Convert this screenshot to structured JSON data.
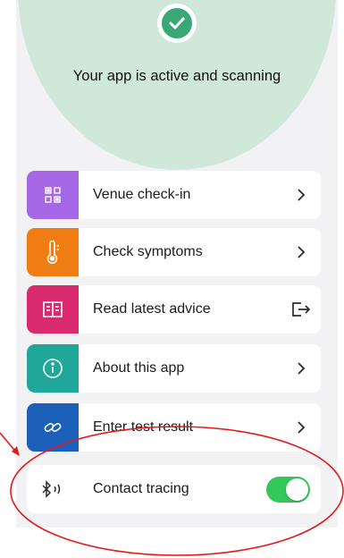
{
  "status": {
    "message": "Your app is active and scanning",
    "accent": "#3aa776",
    "circle_color": "#cfe8da"
  },
  "menu": [
    {
      "label": "Venue check-in",
      "icon": "qr-code-icon",
      "color": "#a567e6",
      "trail": "chevron-right-icon"
    },
    {
      "label": "Check symptoms",
      "icon": "thermometer-icon",
      "color": "#f07c14",
      "trail": "chevron-right-icon"
    },
    {
      "label": "Read latest advice",
      "icon": "book-icon",
      "color": "#d92a6d",
      "trail": "open-external-icon"
    },
    {
      "label": "About this app",
      "icon": "info-icon",
      "color": "#1fa79a",
      "trail": "chevron-right-icon"
    },
    {
      "label": "Enter test result",
      "icon": "link-icon",
      "color": "#1c5fb8",
      "trail": "chevron-right-icon"
    }
  ],
  "contact_tracing": {
    "label": "Contact tracing",
    "icon": "bluetooth-icon",
    "enabled": true,
    "switch_color": "#34c759"
  },
  "annotation_color": "#e11b1b"
}
